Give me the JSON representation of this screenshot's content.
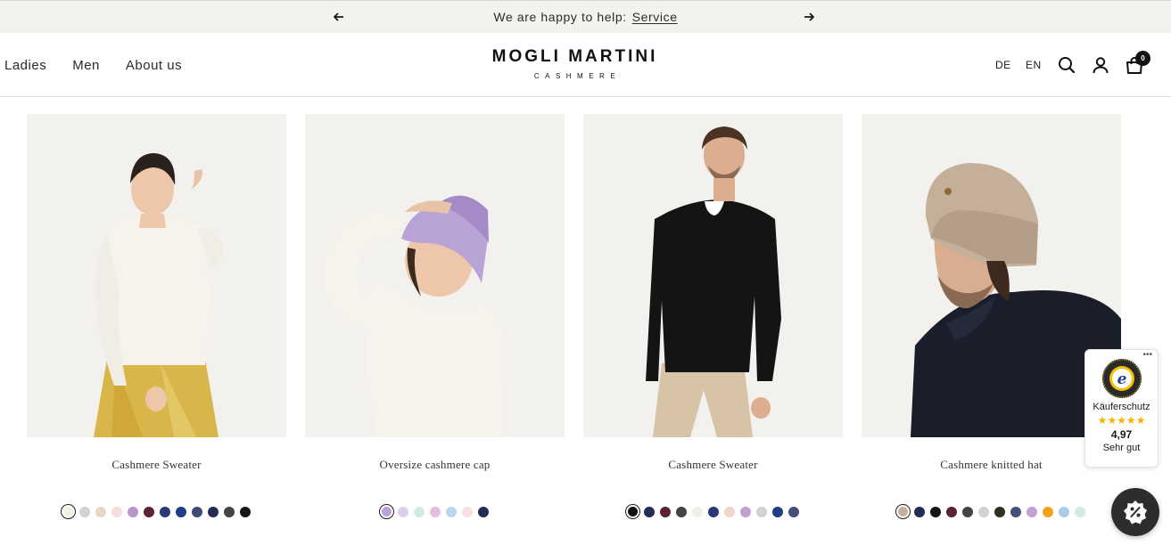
{
  "announcement": {
    "text": "We are happy to help:",
    "link": "Service",
    "prev_icon": "arrow-left-icon",
    "next_icon": "arrow-right-icon"
  },
  "header": {
    "nav": [
      "Ladies",
      "Men",
      "About us"
    ],
    "logo_main": "MOGLI MARTINI",
    "logo_sub": "CASHMERE",
    "languages": [
      "DE",
      "EN"
    ],
    "cart_count": "0",
    "icons": [
      "search-icon",
      "account-icon",
      "cart-icon"
    ]
  },
  "products": [
    {
      "title": "Cashmere Sweater",
      "swatches": [
        "#f4f0e4",
        "#d2d2d2",
        "#e9d6c4",
        "#f6dede",
        "#b995c9",
        "#5a2232",
        "#2a3a78",
        "#1f3d86",
        "#3d4a78",
        "#232c52",
        "#444444",
        "#151515"
      ],
      "active": 0
    },
    {
      "title": "Oversize cashmere cap",
      "swatches": [
        "#b8a2d6",
        "#ddd0ee",
        "#d0ebe0",
        "#e4bede",
        "#b8d6ec",
        "#f7e0e3",
        "#232c52"
      ],
      "active": 0
    },
    {
      "title": "Cashmere Sweater",
      "swatches": [
        "#111111",
        "#232c52",
        "#5a2232",
        "#444444",
        "#f2efe4",
        "#2a3a78",
        "#efd6cc",
        "#c2a0d2",
        "#d2d2d2",
        "#1f3d86",
        "#44507a"
      ],
      "active": 0
    },
    {
      "title": "Cashmere knitted hat",
      "swatches": [
        "#c6b09c",
        "#232c52",
        "#151515",
        "#5a2232",
        "#444444",
        "#d2d2d2",
        "#2f2f22",
        "#44507a",
        "#c2a0d2",
        "#f5a11a",
        "#a9cbe8",
        "#d0ebe0"
      ],
      "active": 0
    }
  ],
  "trusted_shops": {
    "label": "Käuferschutz",
    "stars": "★★★★★",
    "score": "4,97",
    "grade": "Sehr gut",
    "seal_text": "TRUSTED SHOPS GUARANTEE",
    "menu_icon": "more-dots-icon"
  },
  "discount_icon": "percent-badge-icon",
  "colors": {
    "announce_bg": "#f3f2ee",
    "photo_bg": "#f2f1ee",
    "star": "#f5b301"
  }
}
